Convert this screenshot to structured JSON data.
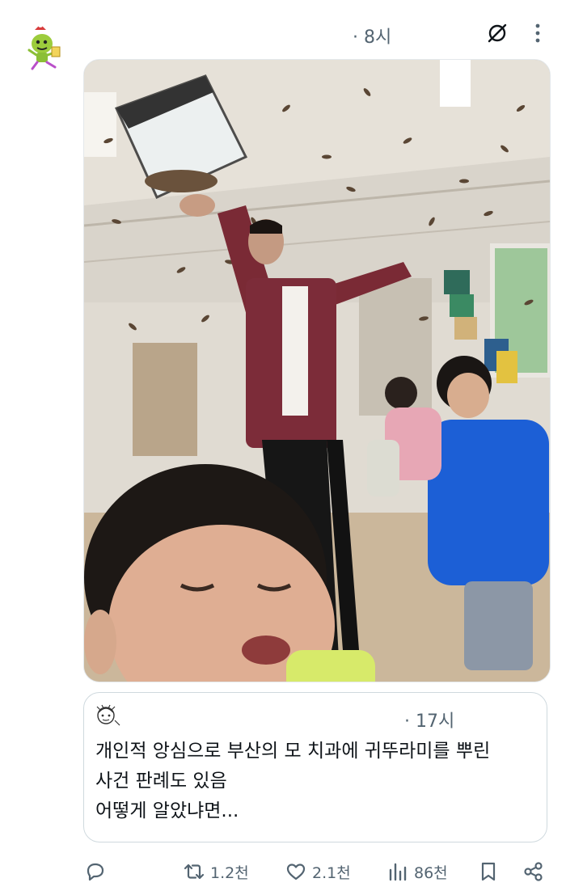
{
  "post": {
    "timestamp": "· 8시"
  },
  "quote": {
    "timestamp": "· 17시",
    "text": "개인적 앙심으로 부산의 모 치과에 귀뚜라미를 뿌린\n사건 판례도 있음\n어떻게 알았냐면..."
  },
  "actions": {
    "reply_count": "",
    "repost_count": "1.2천",
    "like_count": "2.1천",
    "views_count": "86천"
  },
  "icons": {
    "grok": "grok-icon",
    "more": "more-icon",
    "reply": "reply-icon",
    "repost": "repost-icon",
    "like": "heart-icon",
    "views": "views-icon",
    "bookmark": "bookmark-icon",
    "share": "share-icon"
  },
  "colors": {
    "muted": "#536471",
    "text": "#0f1419",
    "border": "#cfd9de"
  }
}
